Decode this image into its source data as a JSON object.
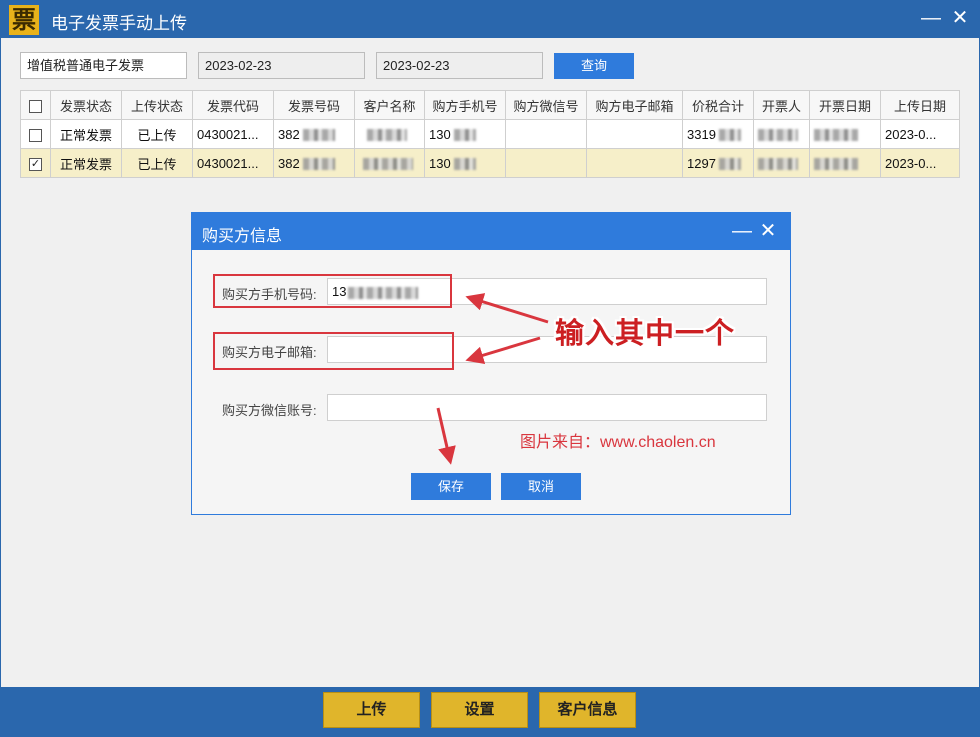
{
  "app": {
    "logo_char": "票",
    "title": "电子发票手动上传",
    "minimize": "—",
    "close": "✕"
  },
  "filters": {
    "invoice_type": "增值税普通电子发票",
    "date_from": "2023-02-23",
    "date_to": "2023-02-23",
    "query_label": "查询"
  },
  "table": {
    "columns": [
      "发票状态",
      "上传状态",
      "发票代码",
      "发票号码",
      "客户名称",
      "购方手机号",
      "购方微信号",
      "购方电子邮箱",
      "价税合计",
      "开票人",
      "开票日期",
      "上传日期"
    ],
    "rows": [
      {
        "checked": false,
        "check_mark": "",
        "status": "正常发票",
        "upload": "已上传",
        "code": "0430021...",
        "number": "382",
        "customer": "",
        "phone": "130",
        "wechat": "",
        "email": "",
        "total": "3319",
        "drawer": "",
        "date": "",
        "upload_date": "2023-0..."
      },
      {
        "checked": true,
        "check_mark": "✓",
        "status": "正常发票",
        "upload": "已上传",
        "code": "0430021...",
        "number": "382",
        "customer": "",
        "phone": "130",
        "wechat": "",
        "email": "",
        "total": "1297",
        "drawer": "",
        "date": "",
        "upload_date": "2023-0..."
      }
    ]
  },
  "dialog": {
    "title": "购买方信息",
    "minimize": "—",
    "close": "✕",
    "phone_label": "购买方手机号码:",
    "phone_value": "13",
    "email_label": "购买方电子邮箱:",
    "email_value": "",
    "wechat_label": "购买方微信账号:",
    "wechat_value": "",
    "save_label": "保存",
    "cancel_label": "取消"
  },
  "annotation": {
    "text": "输入其中一个",
    "source": "图片来自：www.chaolen.cn",
    "color": "#d9363e"
  },
  "bottom": {
    "upload_label": "上传",
    "settings_label": "设置",
    "customer_label": "客户信息"
  }
}
